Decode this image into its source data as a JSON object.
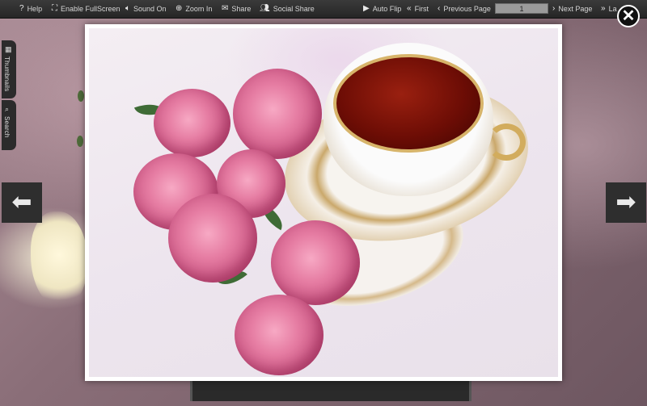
{
  "toolbar": {
    "help": "Help",
    "fullscreen": "Enable FullScreen",
    "sound": "Sound On",
    "zoom": "Zoom In",
    "share": "Share",
    "social_share": "Social Share",
    "auto_flip": "Auto Flip",
    "first": "First",
    "previous_page": "Previous Page",
    "page_number": "1",
    "next_page": "Next Page",
    "last": "La"
  },
  "side_tabs": {
    "thumbnails": "Thumbnails",
    "search": "Search"
  },
  "icons": {
    "close": "close-icon",
    "prev": "arrow-left-icon",
    "next": "arrow-right-icon"
  }
}
